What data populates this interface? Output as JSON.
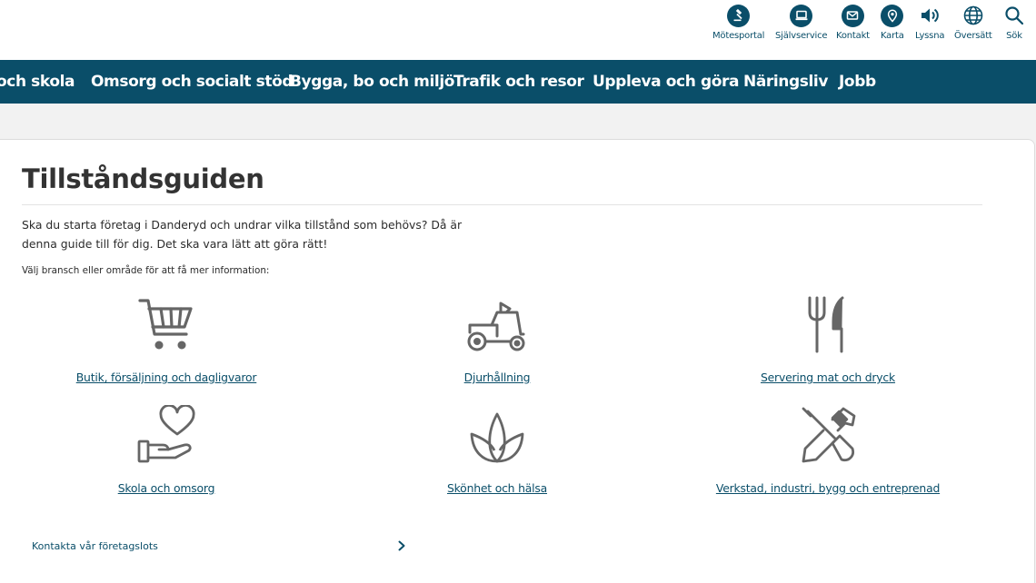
{
  "utility_nav": [
    {
      "id": "motesportal",
      "label": "Mötesportal",
      "icon": "gavel-icon"
    },
    {
      "id": "sjalvservice",
      "label": "Självservice",
      "icon": "laptop-icon"
    },
    {
      "id": "kontakt",
      "label": "Kontakt",
      "icon": "mail-icon"
    },
    {
      "id": "karta",
      "label": "Karta",
      "icon": "map-pin-icon"
    },
    {
      "id": "lyssna",
      "label": "Lyssna",
      "icon": "speaker-icon"
    },
    {
      "id": "oversatt",
      "label": "Översätt",
      "icon": "globe-icon"
    },
    {
      "id": "sok",
      "label": "Sök",
      "icon": "search-icon"
    }
  ],
  "main_nav": [
    "och skola",
    "Omsorg och socialt stöd",
    "Bygga, bo och miljö",
    "Trafik och resor",
    "Uppleva och göra",
    "Näringsliv",
    "Jobb"
  ],
  "page": {
    "title": "Tillståndsguiden",
    "intro": "Ska du starta företag i Danderyd och undrar vilka tillstånd som behövs? Då är denna guide till för dig. Det ska vara lätt att göra rätt!",
    "choose_label": "Välj bransch eller område för att få mer information:"
  },
  "categories": [
    {
      "label": "Butik, försäljning och dagligvaror",
      "icon": "shopping-cart-icon"
    },
    {
      "label": "Djurhållning",
      "icon": "tractor-icon"
    },
    {
      "label": "Servering mat och dryck",
      "icon": "fork-knife-icon"
    },
    {
      "label": "Skola och omsorg",
      "icon": "heart-hand-icon"
    },
    {
      "label": "Skönhet och hälsa",
      "icon": "lotus-icon"
    },
    {
      "label": "Verkstad, industri, bygg och entreprenad",
      "icon": "hammer-screwdriver-icon"
    }
  ],
  "contact": {
    "label": "Kontakta vår företagslots",
    "icon": "chevron-right-icon"
  },
  "colors": {
    "brand": "#0a4e69",
    "icon_gray": "#666666",
    "background": "#f2f2f2"
  }
}
